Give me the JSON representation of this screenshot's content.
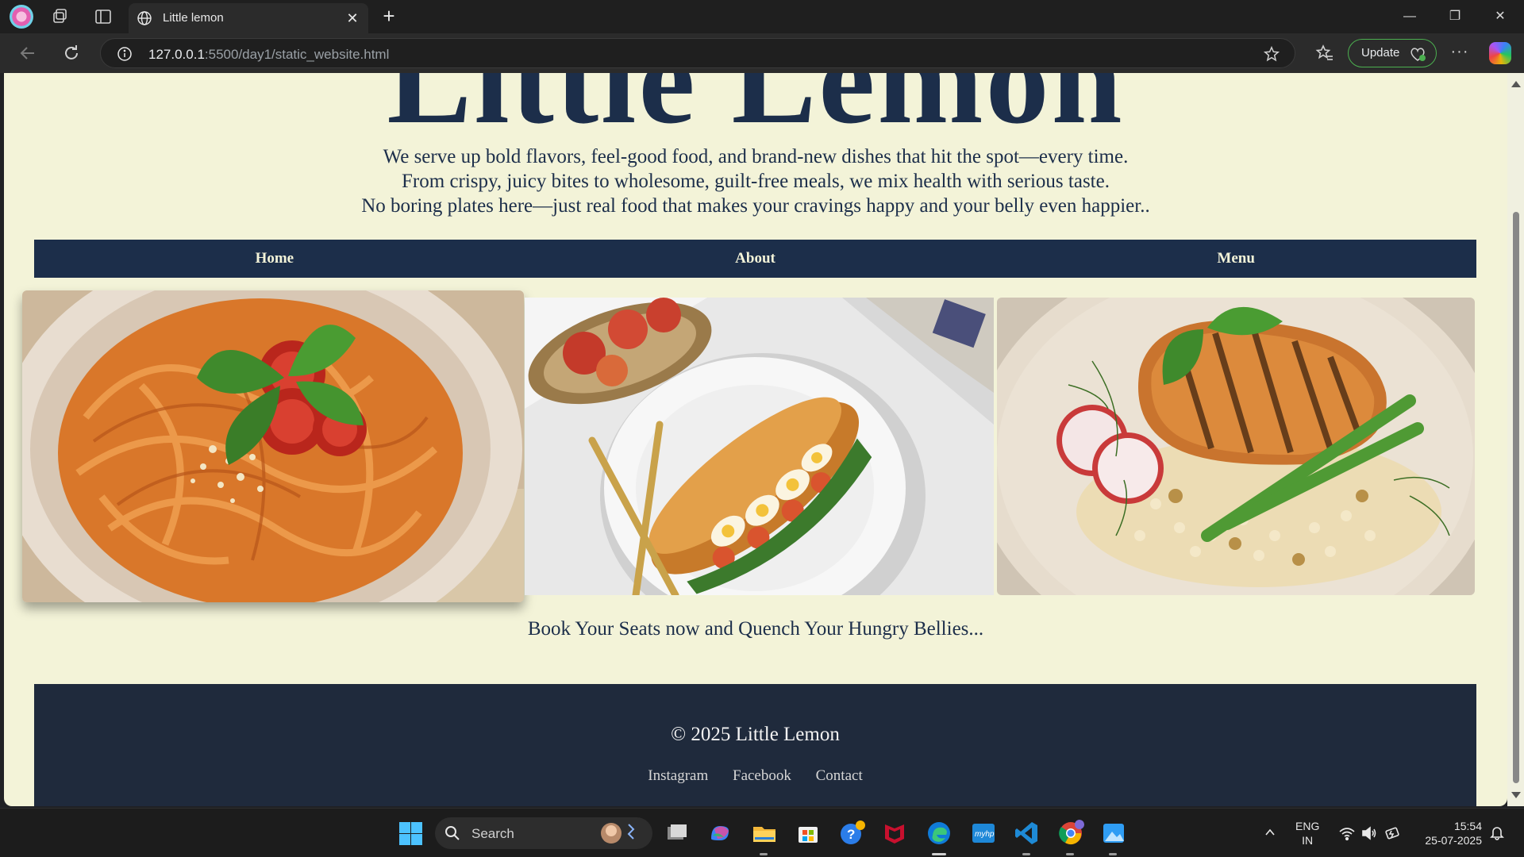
{
  "browser": {
    "tab_title": "Little lemon",
    "url_host": "127.0.0.1",
    "url_path": ":5500/day1/static_website.html",
    "update_label": "Update"
  },
  "page": {
    "hero_title": "Little Lemon",
    "intro_lines": [
      "We serve up bold flavors, feel-good food, and brand-new dishes that hit the spot—every time.",
      "From crispy, juicy bites to wholesome, guilt-free meals, we mix health with serious taste.",
      "No boring plates here—just real food that makes your cravings happy and your belly even happier.."
    ],
    "nav": [
      "Home",
      "About",
      "Menu"
    ],
    "cta": "Book Your Seats now and Quench Your Hungry Bellies...",
    "footer": {
      "copyright": "© 2025 Little Lemon",
      "links": [
        "Instagram",
        "Facebook",
        "Contact"
      ]
    },
    "colors": {
      "cream": "#f3f3d8",
      "navy": "#1c2e4a",
      "footer_bg": "#1f2a3c"
    }
  },
  "taskbar": {
    "search_label": "Search",
    "lang_line1": "ENG",
    "lang_line2": "IN",
    "time": "15:54",
    "date": "25-07-2025"
  }
}
